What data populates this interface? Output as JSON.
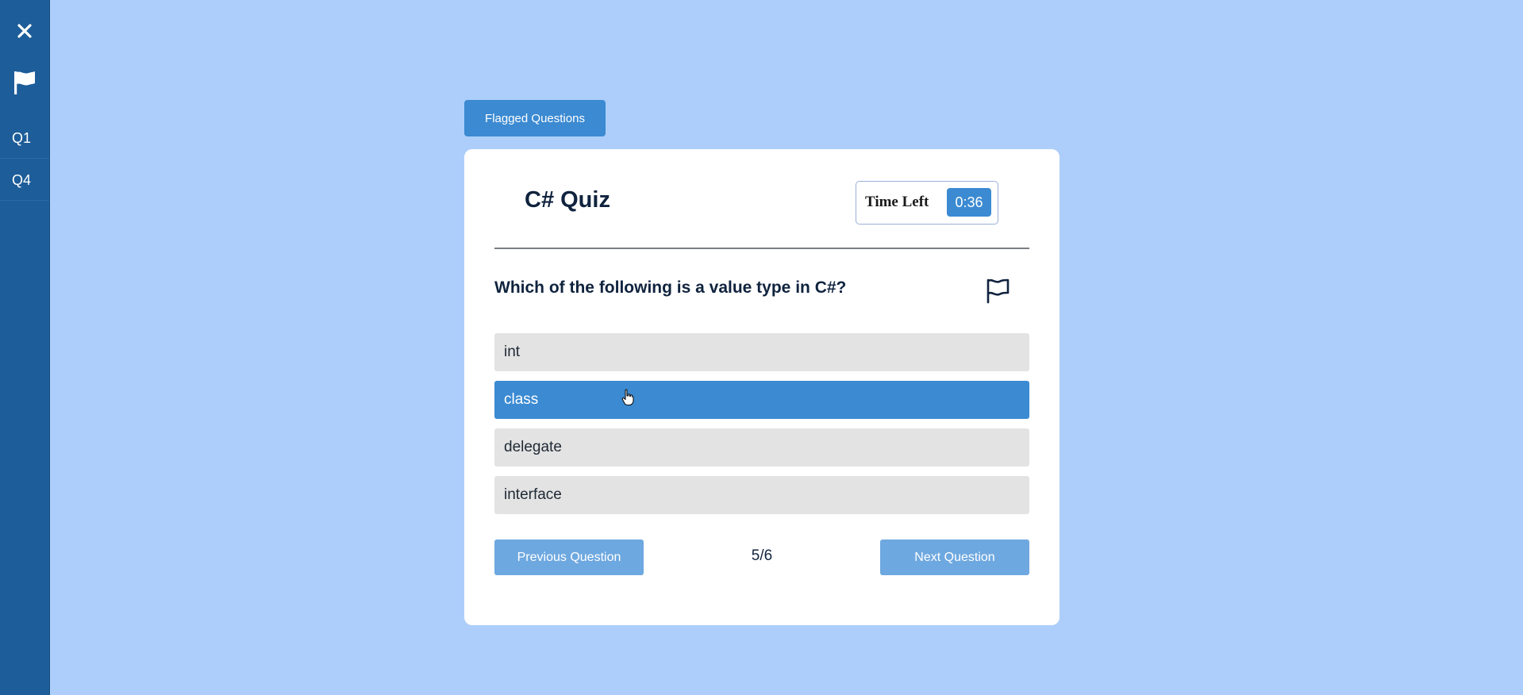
{
  "sidebar": {
    "close_icon": "close-icon",
    "flag_icon": "flag-icon",
    "flagged_items": [
      {
        "label": "Q1"
      },
      {
        "label": "Q4"
      }
    ]
  },
  "flagged_button": {
    "label": "Flagged Questions"
  },
  "quiz": {
    "title": "C# Quiz",
    "timer": {
      "label": "Time Left",
      "value": "0:36"
    },
    "question": "Which of the following is a value type in C#?",
    "flag_icon": "flag-outline-icon",
    "options": [
      {
        "label": "int",
        "selected": false
      },
      {
        "label": "class",
        "selected": true
      },
      {
        "label": "delegate",
        "selected": false
      },
      {
        "label": "interface",
        "selected": false
      }
    ],
    "previous_label": "Previous Question",
    "next_label": "Next Question",
    "counter": "5/6"
  },
  "colors": {
    "background": "#adcefa",
    "sidebar": "#1d5d99",
    "accent": "#3b8ad2",
    "nav_button": "#6ea8e0",
    "option": "#e3e3e3"
  }
}
